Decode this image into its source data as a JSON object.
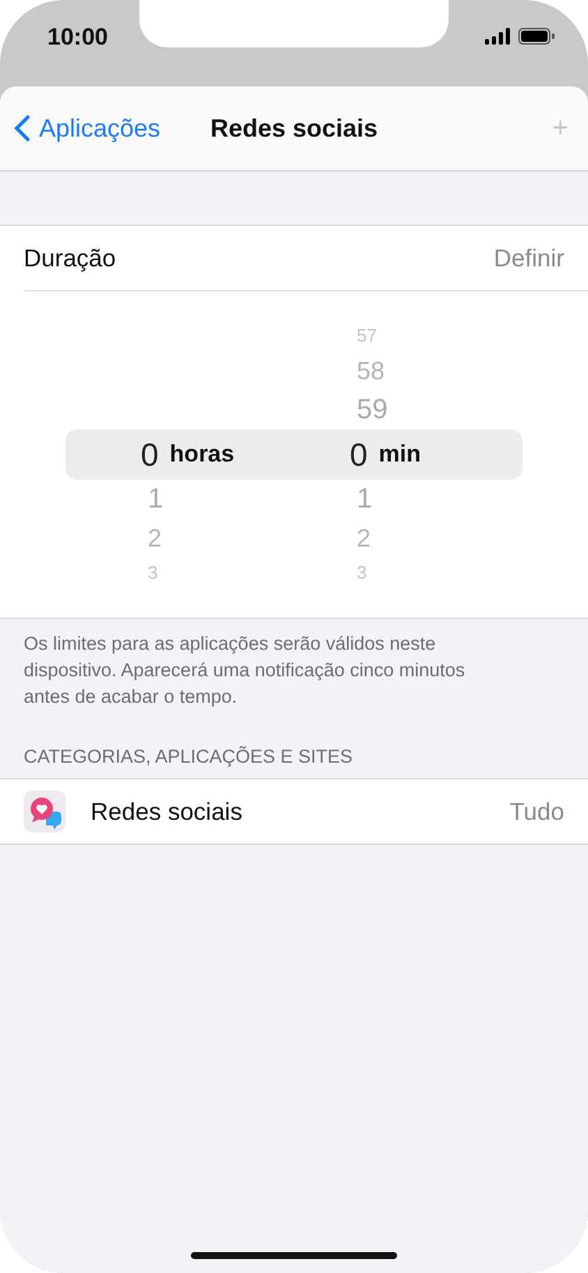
{
  "status_bar": {
    "time": "10:00"
  },
  "nav": {
    "back": "Aplicações",
    "title": "Redes sociais",
    "action": {
      "label": "+",
      "disabled": true
    }
  },
  "duration": {
    "label": "Duração",
    "value": "Definir"
  },
  "picker": {
    "columns": [
      {
        "selected": "0",
        "unit": "horas",
        "below": [
          "1",
          "2",
          "3"
        ]
      },
      {
        "above": [
          "57",
          "58",
          "59"
        ],
        "selected": "0",
        "unit": "min",
        "below": [
          "1",
          "2",
          "3"
        ]
      }
    ]
  },
  "note": "Os limites para as aplicações serão válidos neste dispositivo. Aparecerá uma notificação cinco minutos antes de acabar o tempo.",
  "section_header": "CATEGORIAS, APLICAÇÕES E SITES",
  "rows": [
    {
      "label": "Redes sociais",
      "value": "Tudo"
    }
  ]
}
